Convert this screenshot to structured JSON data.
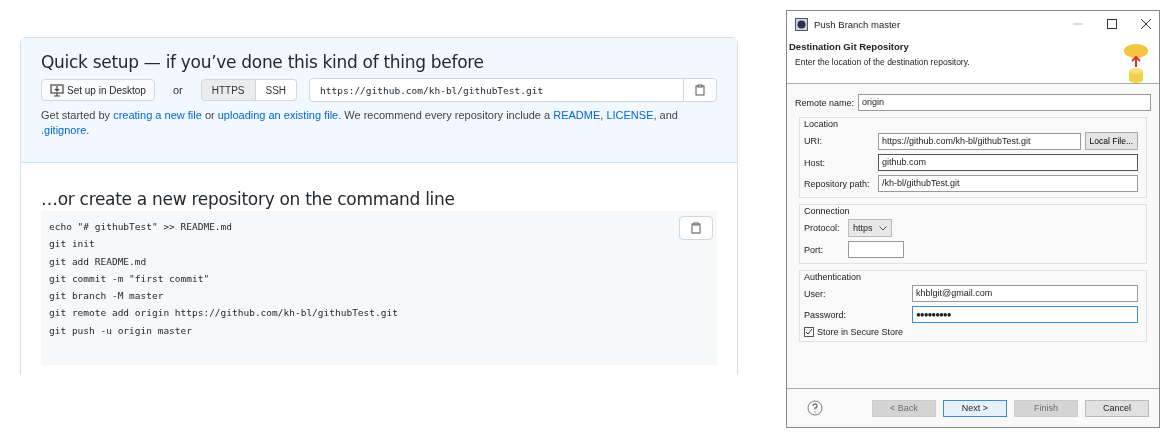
{
  "quick_setup": {
    "title": "Quick setup — if you’ve done this kind of thing before",
    "desktop_button": "Set up in Desktop",
    "or": "or",
    "protocols": [
      {
        "label": "HTTPS",
        "selected": true
      },
      {
        "label": "SSH",
        "selected": false
      }
    ],
    "url": "https://github.com/kh-bl/githubTest.git",
    "intro": [
      {
        "kind": "plain",
        "text": "Get started by "
      },
      {
        "kind": "link",
        "text": "creating a new file"
      },
      {
        "kind": "plain",
        "text": " or "
      },
      {
        "kind": "link",
        "text": "uploading an existing file"
      },
      {
        "kind": "plain",
        "text": ". We recommend every repository include a "
      },
      {
        "kind": "link",
        "text": "README"
      },
      {
        "kind": "plain",
        "text": ", "
      },
      {
        "kind": "link",
        "text": "LICENSE"
      },
      {
        "kind": "plain",
        "text": ", and "
      },
      {
        "kind": "link",
        "text": ".gitignore"
      },
      {
        "kind": "plain",
        "text": "."
      }
    ]
  },
  "command_line": {
    "title": "…or create a new repository on the command line",
    "lines": [
      "echo \"# githubTest\" >> README.md",
      "git init",
      "git add README.md",
      "git commit -m \"first commit\"",
      "git branch -M master",
      "git remote add origin https://github.com/kh-bl/githubTest.git",
      "git push -u origin master"
    ]
  },
  "dialog": {
    "title": "Push Branch master",
    "header_title": "Destination Git Repository",
    "header_subtitle": "Enter the location of the destination repository.",
    "remote_name": {
      "label": "Remote name:",
      "value": "origin"
    },
    "location": {
      "legend": "Location",
      "uri": {
        "label": "URI:",
        "value": "https://github.com/kh-bl/githubTest.git"
      },
      "local_file_button": "Local File...",
      "host": {
        "label": "Host:",
        "value": "github.com"
      },
      "path": {
        "label": "Repository path:",
        "value": "/kh-bl/githubTest.git"
      }
    },
    "connection": {
      "legend": "Connection",
      "protocol": {
        "label": "Protocol:",
        "value": "https"
      },
      "port": {
        "label": "Port:"
      }
    },
    "authentication": {
      "legend": "Authentication",
      "user": {
        "label": "User:",
        "value": "khblgit@gmail.com"
      },
      "password": {
        "label": "Password:",
        "value": "●●●●●●●●●"
      },
      "store": {
        "label": "Store in Secure Store",
        "checked": true
      }
    },
    "buttons": [
      {
        "label": "< Back",
        "disabled": true,
        "default": false
      },
      {
        "label": "Next >",
        "disabled": false,
        "default": true
      },
      {
        "label": "Finish",
        "disabled": true,
        "default": false
      },
      {
        "label": "Cancel",
        "disabled": false,
        "default": false
      }
    ]
  }
}
